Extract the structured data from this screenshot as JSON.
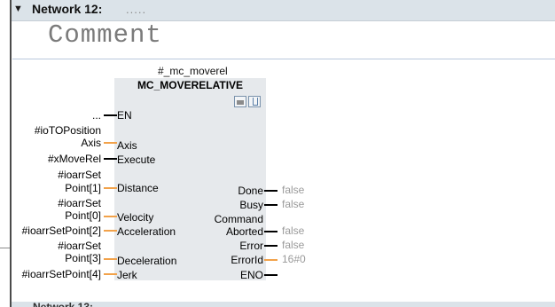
{
  "network": {
    "title": "Network 12:",
    "title_comment": "....."
  },
  "comment": "Comment",
  "block": {
    "instance": "#_mc_moverel",
    "type": "MC_MOVERELATIVE"
  },
  "inputs": {
    "en": {
      "arg": "...",
      "param": "EN"
    },
    "axis": {
      "arg1": "#ioTOPosition",
      "arg2": "Axis",
      "param": "Axis"
    },
    "execute": {
      "arg": "#xMoveRel",
      "param": "Execute"
    },
    "distance": {
      "arg1": "#ioarrSet",
      "arg2": "Point[1]",
      "param": "Distance"
    },
    "velocity": {
      "arg1": "#ioarrSet",
      "arg2": "Point[0]",
      "param": "Velocity"
    },
    "acceleration": {
      "arg": "#ioarrSetPoint[2]",
      "param": "Acceleration"
    },
    "deceleration": {
      "arg1": "#ioarrSet",
      "arg2": "Point[3]",
      "param": "Deceleration"
    },
    "jerk": {
      "arg": "#ioarrSetPoint[4]",
      "param": "Jerk"
    }
  },
  "outputs": {
    "done": {
      "param": "Done",
      "value": "false"
    },
    "busy": {
      "param": "Busy",
      "value": "false"
    },
    "command_aborted": {
      "param1": "Command",
      "param2": "Aborted",
      "value": "false"
    },
    "error": {
      "param": "Error",
      "value": "false"
    },
    "errorid": {
      "param": "ErrorId",
      "value": "16#0"
    },
    "eno": {
      "param": "ENO"
    }
  },
  "next_network": {
    "title": "Network 13:"
  },
  "colors": {
    "header_bg": "#dbe3e9",
    "block_bg": "#e6e9ec",
    "wire_orange": "#f2a24a",
    "value_gray": "#9a9a9a"
  }
}
